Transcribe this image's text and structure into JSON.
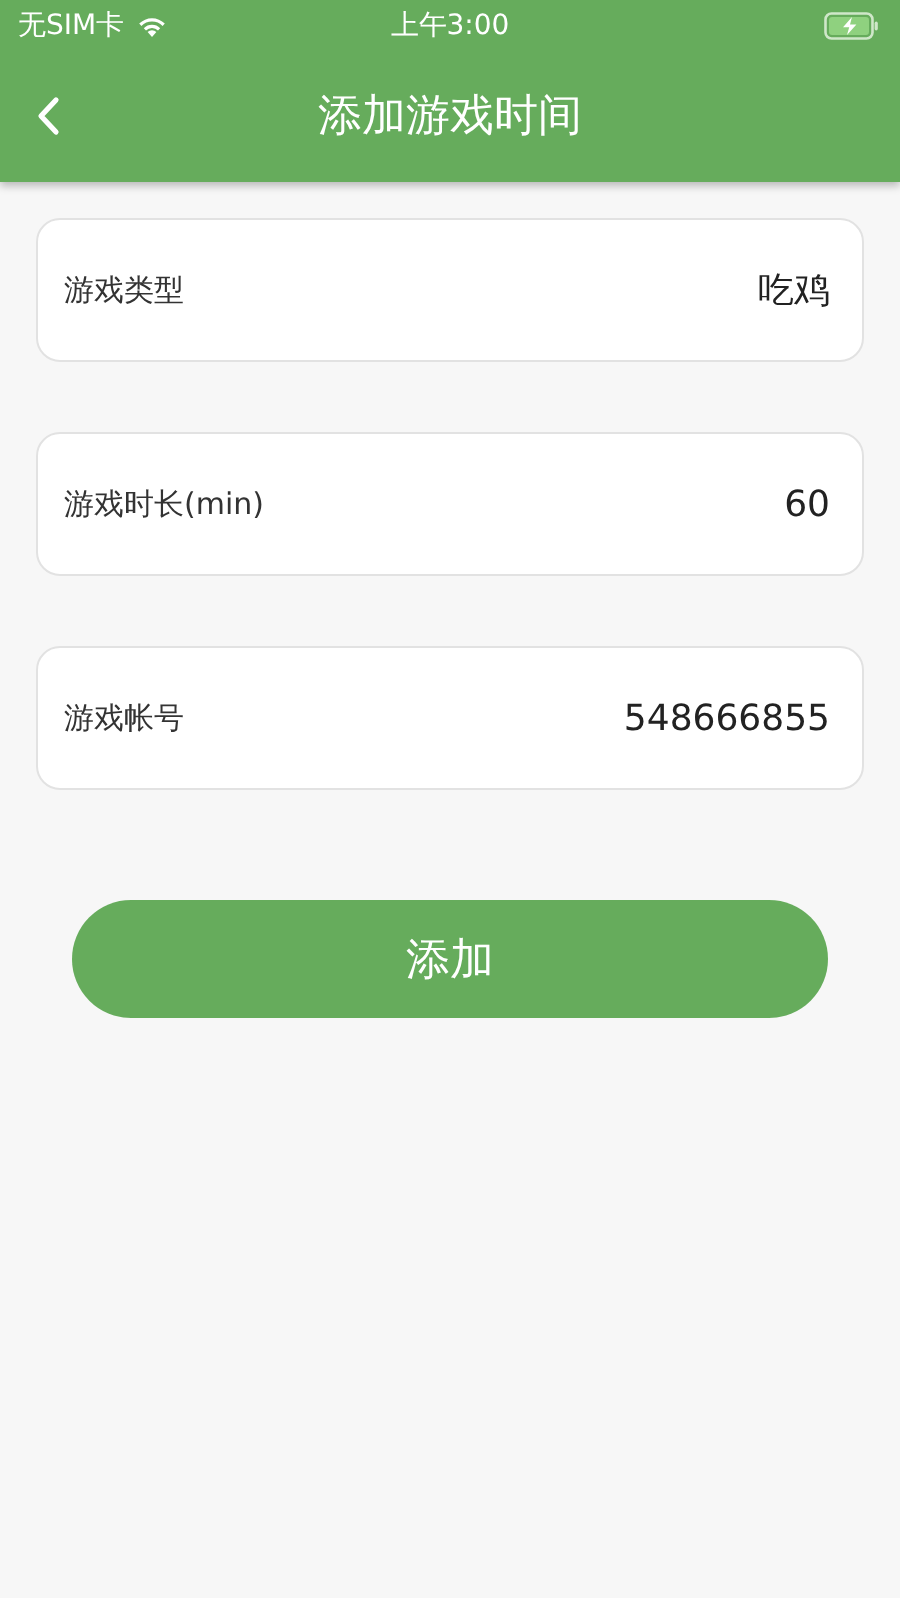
{
  "status_bar": {
    "carrier": "无SIM卡",
    "time": "上午3:00",
    "battery_charging": true
  },
  "nav_bar": {
    "title": "添加游戏时间"
  },
  "fields": [
    {
      "label": "游戏类型",
      "value": "吃鸡"
    },
    {
      "label": "游戏时长(min)",
      "value": "60"
    },
    {
      "label": "游戏帐号",
      "value": "548666855"
    }
  ],
  "submit_button": "添加"
}
